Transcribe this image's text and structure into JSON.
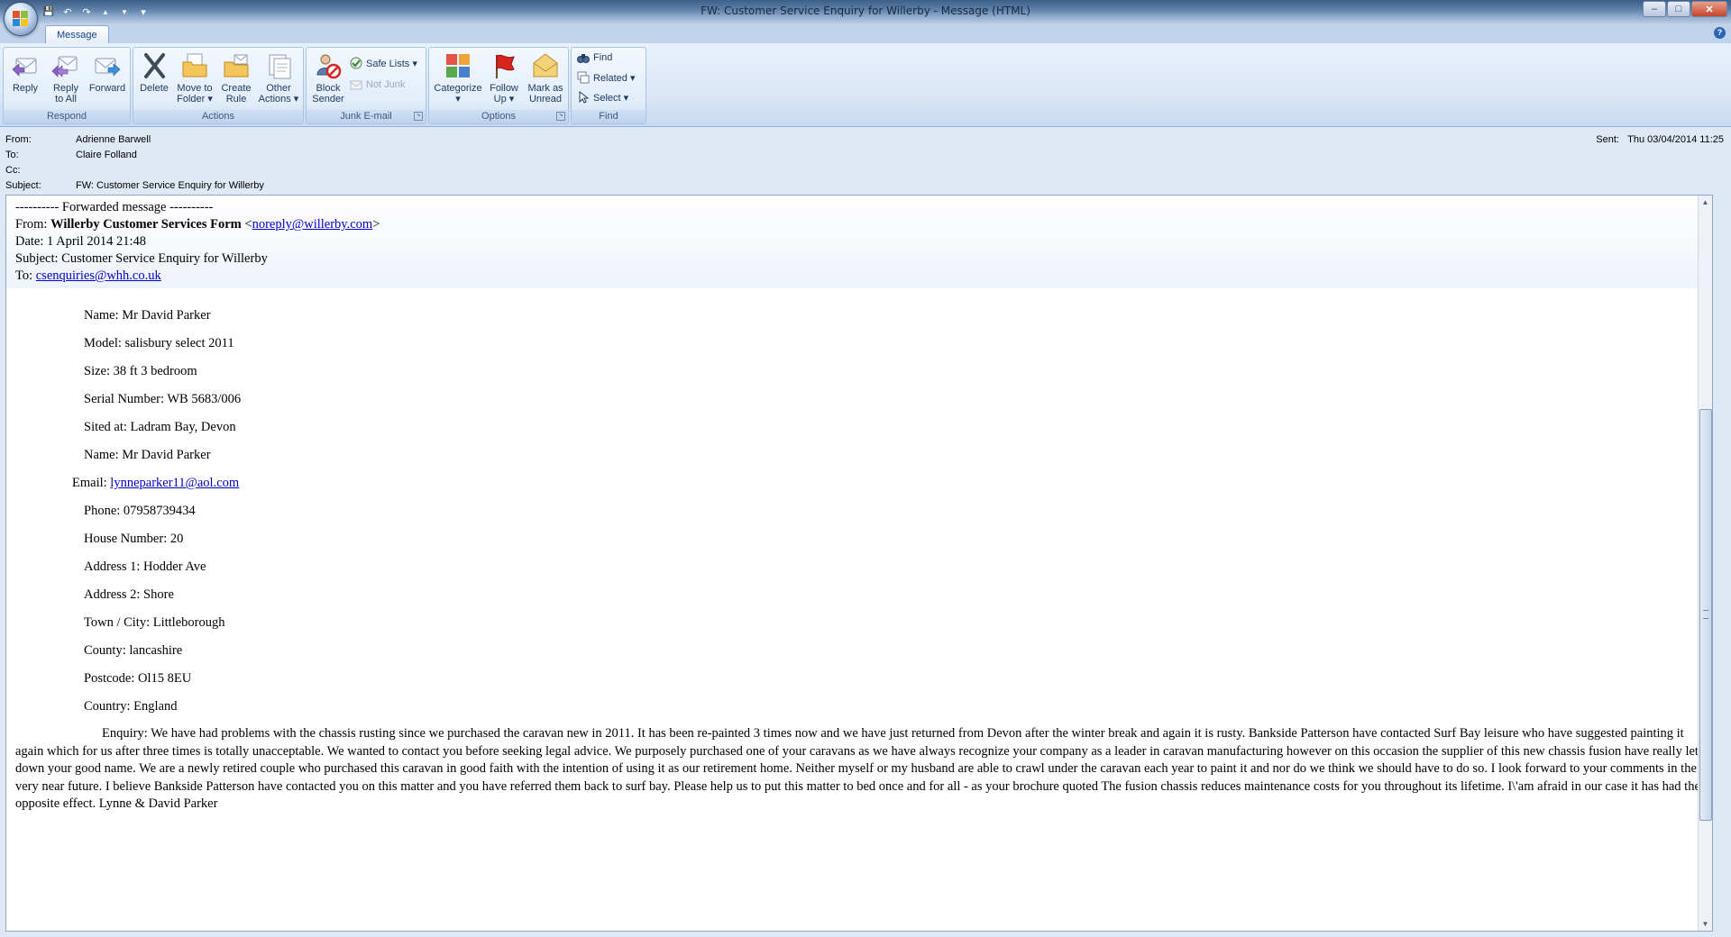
{
  "window": {
    "title": "FW: Customer Service Enquiry for Willerby - Message (HTML)",
    "minimize": "–",
    "maximize": "□",
    "close": "✕"
  },
  "qat": {
    "save": "💾",
    "undo": "↶",
    "redo": "↷",
    "prev": "▲",
    "next": "▼",
    "customize": "▾"
  },
  "tabs": [
    {
      "label": "Message"
    }
  ],
  "help": "?",
  "ribbon": {
    "respond": {
      "label": "Respond",
      "reply": "Reply",
      "reply_all_1": "Reply",
      "reply_all_2": "to All",
      "forward": "Forward"
    },
    "actions": {
      "label": "Actions",
      "delete": "Delete",
      "move_1": "Move to",
      "move_2": "Folder ▾",
      "create_1": "Create",
      "create_2": "Rule",
      "other_1": "Other",
      "other_2": "Actions ▾"
    },
    "junk": {
      "label": "Junk E-mail",
      "block_1": "Block",
      "block_2": "Sender",
      "safe_lists": "Safe Lists ▾",
      "not_junk": "Not Junk"
    },
    "options": {
      "label": "Options",
      "categorize": "Categorize",
      "categorize_arrow": "▾",
      "follow_1": "Follow",
      "follow_2": "Up ▾",
      "mark_1": "Mark as",
      "mark_2": "Unread"
    },
    "find": {
      "label": "Find",
      "find": "Find",
      "related": "Related ▾",
      "select": "Select ▾"
    }
  },
  "header": {
    "from_label": "From:",
    "from": "Adrienne Barwell",
    "to_label": "To:",
    "to": "Claire Folland",
    "cc_label": "Cc:",
    "cc": "",
    "subject_label": "Subject:",
    "subject": "FW: Customer Service Enquiry for Willerby",
    "sent_label": "Sent:",
    "sent": "Thu 03/04/2014 11:25"
  },
  "body": {
    "fwd_marker": "---------- Forwarded message ----------",
    "from_prefix": "From: ",
    "from_name": "Willerby Customer Services Form",
    "from_open": " <",
    "from_email": "noreply@willerby.com",
    "from_close": ">",
    "date": "Date: 1 April 2014 21:48",
    "subject": "Subject: Customer Service Enquiry for Willerby",
    "to_prefix": "To: ",
    "to_email": "csenquiries@whh.co.uk",
    "fields": [
      "Name: Mr David Parker",
      "Model: salisbury select 2011",
      "Size: 38 ft 3 bedroom",
      "Serial Number: WB 5683/006",
      "Sited at: Ladram Bay, Devon",
      "Name: Mr David Parker"
    ],
    "email_label": "Email: ",
    "email_value": "lynneparker11@aol.com",
    "fields2": [
      "Phone: 07958739434",
      "House Number: 20",
      "Address 1: Hodder Ave",
      "Address 2: Shore",
      "Town / City: Littleborough",
      "County: lancashire",
      "Postcode: Ol15 8EU",
      "Country: England"
    ],
    "enquiry": "Enquiry: We have had problems with the chassis rusting since we purchased the caravan new in 2011. It has been re-painted 3 times now and we have just returned from Devon after the winter break and again it is rusty. Bankside Patterson have contacted Surf Bay leisure who have suggested painting it again which for us after three times is totally unacceptable. We wanted to contact you before seeking legal advice. We purposely purchased one of your caravans as we have always recognize your company as a leader in caravan manufacturing however on this occasion the  supplier of this new chassis fusion have really let down your good name. We are a newly retired couple who purchased this caravan in good faith with the intention of using it as our retirement home. Neither myself or my husband are able to crawl under the caravan each year to paint it and nor do we think we should have to do so. I look forward to your comments in the very near future. I believe Bankside Patterson have contacted you on this matter and you have referred them back to surf bay. Please help us to put this matter to bed once and for all - as your brochure quoted The fusion chassis reduces maintenance costs for you throughout its lifetime. I\\'am afraid in our case it has had the opposite effect. Lynne & David Parker"
  },
  "colors": {
    "link": "#0000cc",
    "ribbon_text": "#1f3b61",
    "group_label": "#3b5a82"
  }
}
